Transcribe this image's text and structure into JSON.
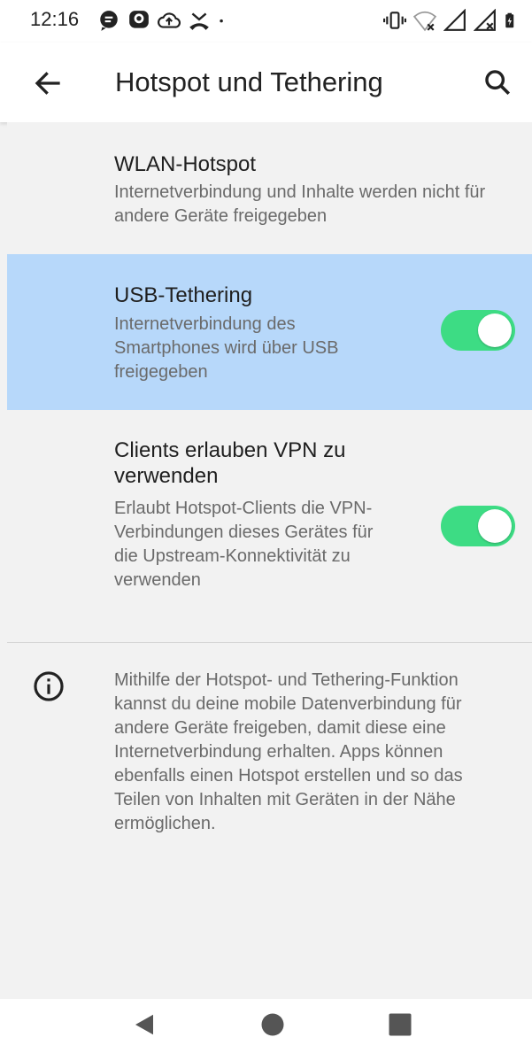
{
  "status_bar": {
    "time": "12:16",
    "left_icons": [
      "chat-bubble-icon",
      "messenger-icon",
      "cloud-upload-icon",
      "missed-call-icon",
      "dot-icon"
    ],
    "right_icons": [
      "vibrate-icon",
      "wifi-off-icon",
      "signal-icon",
      "signal-no-data-icon",
      "battery-charging-icon"
    ]
  },
  "app_bar": {
    "title": "Hotspot und Tethering",
    "back_icon": "arrow-back-icon",
    "search_icon": "search-icon"
  },
  "preferences": {
    "wlan": {
      "title": "WLAN-Hotspot",
      "summary": "Internetverbindung und Inhalte werden nicht für andere Geräte freigegeben"
    },
    "usb": {
      "title": "USB-Tethering",
      "summary": "Internetverbindung des Smartphones wird über USB freigegeben",
      "enabled": true
    },
    "vpn": {
      "title": "Clients erlauben VPN zu verwenden",
      "summary": "Erlaubt Hotspot-Clients die VPN-Verbindungen dieses Gerätes für die Upstream-Konnektivität zu verwenden",
      "enabled": true
    }
  },
  "footer": {
    "icon": "info-icon",
    "text": "Mithilfe der Hotspot- und Tethering-Funktion kannst du deine mobile Datenverbindung für andere Geräte freigeben, damit diese eine Internetverbindung erhalten. Apps können ebenfalls einen Hotspot erstellen und so das Teilen von Inhalten mit Geräten in der Nähe ermöglichen."
  },
  "nav_bar": {
    "buttons": [
      "nav-back-icon",
      "nav-home-icon",
      "nav-recents-icon"
    ]
  },
  "colors": {
    "highlight": "#b7d8fa",
    "switch_on": "#3ddc84",
    "background": "#f2f2f2"
  }
}
